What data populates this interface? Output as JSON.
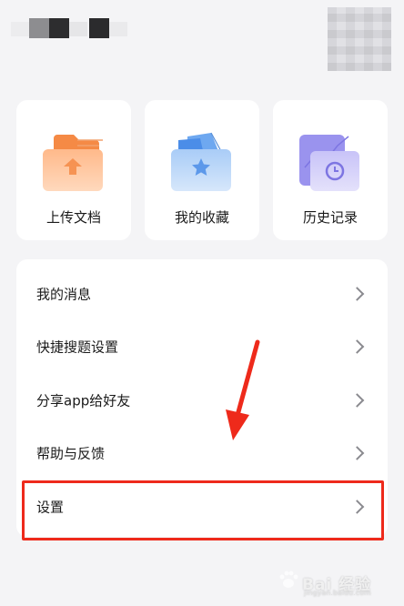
{
  "quick_actions": [
    {
      "label": "上传文档",
      "icon": "folder-upload-icon"
    },
    {
      "label": "我的收藏",
      "icon": "folder-star-icon"
    },
    {
      "label": "历史记录",
      "icon": "history-clock-icon"
    }
  ],
  "menu": [
    {
      "label": "我的消息"
    },
    {
      "label": "快捷搜题设置"
    },
    {
      "label": "分享app给好友"
    },
    {
      "label": "帮助与反馈"
    },
    {
      "label": "设置"
    }
  ],
  "colors": {
    "highlight": "#ee2a1b",
    "background": "#f4f4f6",
    "card": "#ffffff",
    "upload_orange": "#f7924d",
    "favorite_blue": "#5a9ef0",
    "history_purple": "#9a93ee"
  },
  "watermark": {
    "text": "Bai 经验",
    "url": "jingyan.baidu.com"
  }
}
